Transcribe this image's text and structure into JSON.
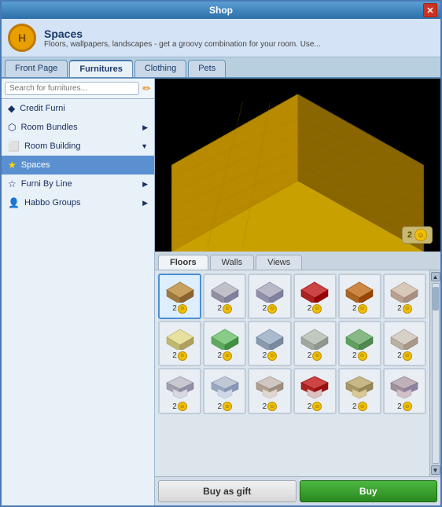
{
  "window": {
    "title": "Shop",
    "close_label": "✕"
  },
  "header": {
    "logo_text": "H",
    "title": "Spaces",
    "subtitle": "Floors, wallpapers, landscapes - get a groovy combination for your room. Use..."
  },
  "tabs": [
    {
      "label": "Front Page",
      "active": false
    },
    {
      "label": "Furnitures",
      "active": true
    },
    {
      "label": "Clothing",
      "active": false
    },
    {
      "label": "Pets",
      "active": false
    }
  ],
  "sidebar": {
    "search_placeholder": "Search for furnitures...",
    "items": [
      {
        "label": "Credit Furni",
        "icon": "diamond",
        "has_arrow": false
      },
      {
        "label": "Room Bundles",
        "icon": "hexagon",
        "has_arrow": true
      },
      {
        "label": "Room Building",
        "icon": "square",
        "has_arrow": true
      },
      {
        "label": "Spaces",
        "icon": "star",
        "has_arrow": false,
        "active": true
      },
      {
        "label": "Furni By Line",
        "icon": "star",
        "has_arrow": true
      },
      {
        "label": "Habbo Groups",
        "icon": "person",
        "has_arrow": true
      }
    ]
  },
  "preview": {
    "coin_count": "2"
  },
  "catalog_tabs": [
    {
      "label": "Floors",
      "active": true
    },
    {
      "label": "Walls",
      "active": false
    },
    {
      "label": "Views",
      "active": false
    }
  ],
  "items": [
    {
      "price": "2",
      "selected": true
    },
    {
      "price": "2",
      "selected": false
    },
    {
      "price": "2",
      "selected": false
    },
    {
      "price": "2",
      "selected": false
    },
    {
      "price": "2",
      "selected": false
    },
    {
      "price": "2",
      "selected": false
    },
    {
      "price": "2",
      "selected": false
    },
    {
      "price": "2",
      "selected": false
    },
    {
      "price": "2",
      "selected": false
    },
    {
      "price": "2",
      "selected": false
    },
    {
      "price": "2",
      "selected": false
    },
    {
      "price": "2",
      "selected": false
    },
    {
      "price": "2",
      "selected": false
    },
    {
      "price": "2",
      "selected": false
    },
    {
      "price": "2",
      "selected": false
    },
    {
      "price": "2",
      "selected": false
    },
    {
      "price": "2",
      "selected": false
    },
    {
      "price": "2",
      "selected": false
    }
  ],
  "buttons": {
    "buy_gift_label": "Buy as gift",
    "buy_label": "Buy"
  },
  "colors": {
    "accent_blue": "#4a7ab5",
    "active_tab": "#5a90d0",
    "buy_green": "#2a8820"
  }
}
